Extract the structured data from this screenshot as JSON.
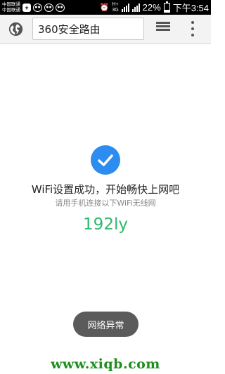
{
  "status_bar": {
    "carrier_1": "中国联通",
    "carrier_2": "中国联通",
    "network_type": "3G",
    "network_h": "H+",
    "battery_text": "22%",
    "battery_level": 0.22,
    "time": "下午3:54"
  },
  "toolbar": {
    "url_text": "360安全路由"
  },
  "content": {
    "title": "WiFi设置成功，开始畅快上网吧",
    "subtitle": "请用手机连接以下WiFi无线网",
    "ssid": "192ly",
    "accent_color": "#2d8cf0",
    "ssid_color": "#2fb86c"
  },
  "toast": {
    "text": "网络异常"
  },
  "watermark": {
    "text": "www.xiqb.com"
  }
}
